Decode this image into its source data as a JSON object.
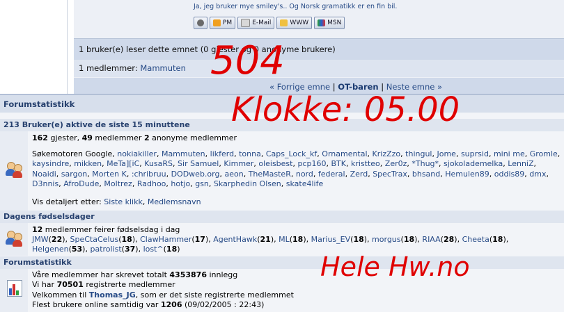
{
  "post": {
    "signature": "Ja, jeg bruker mye smiley's.. Og Norsk gramatikk er en fin bil.",
    "buttons": [
      "PM",
      "E-Mail",
      "WWW",
      "MSN"
    ]
  },
  "readers": {
    "reading_text": "1 bruker(e) leser dette emnet (0 gjester og 0 anonyme brukere)",
    "members_prefix": "1 medlemmer: ",
    "member": "Mammuten"
  },
  "nav": {
    "prev": "« Forrige emne",
    "sep1": " | ",
    "current": "OT-baren",
    "sep2": " | ",
    "next": "Neste emne »"
  },
  "stats": {
    "title": "Forumstatistikk",
    "active_header": "213 Bruker(e) aktive de siste 15 minuttene",
    "active_counts": {
      "guests_num": "162",
      "guests_label": " gjester, ",
      "members_num": "49",
      "members_label": " medlemmer ",
      "anon_num": "2",
      "anon_label": " anonyme medlemmer"
    },
    "online_prefix": "Søkemotoren Google, ",
    "online_users": [
      "nokiakiller",
      "Mammuten",
      "likferd",
      "tonna",
      "Caps_Lock_kf",
      "Ornamental",
      "KrizZzo",
      "thingul",
      "Jome",
      "suprsid",
      "mini me",
      "Gromle",
      "kaysindre",
      "mikken",
      "MeTa][iC",
      "KusaRS",
      "Sir Samuel",
      "Kimmer",
      "oleisbest",
      "pcp160",
      "BTK",
      "kristteo",
      "Zer0z",
      "*Thug*",
      "sjokolademelka",
      "LenniZ",
      "Noaidi",
      "sargon",
      "Morten K",
      ":chribruu",
      "DODweb.org",
      "aeon",
      "TheMasteR",
      "nord",
      "federal",
      "Zerd",
      "SpecTrax",
      "bhsand",
      "Hemulen89",
      "oddis89",
      "dmx",
      "D3nnis",
      "AfroDude",
      "Moltrez",
      "Radhoo",
      "hotjo",
      "gsn",
      "Skarphedin Olsen",
      "skate4life"
    ],
    "sort_prefix": "Vis detaljert etter: ",
    "sort_options": [
      "Siste klikk",
      "Medlemsnavn"
    ],
    "birthday_header": "Dagens fødselsdager",
    "birthday_count_num": "12",
    "birthday_count_label": " medlemmer feirer fødselsdag i dag",
    "birthdays": [
      {
        "name": "JMW",
        "age": "22"
      },
      {
        "name": "SpeCtaCelus",
        "age": "18"
      },
      {
        "name": "ClawHammer",
        "age": "17"
      },
      {
        "name": "AgentHawk",
        "age": "21"
      },
      {
        "name": "ML",
        "age": "18"
      },
      {
        "name": "Marius_EV",
        "age": "18"
      },
      {
        "name": "morgus",
        "age": "18"
      },
      {
        "name": "RIAA",
        "age": "28"
      },
      {
        "name": "Cheeta",
        "age": "18"
      },
      {
        "name": "Helgenen",
        "age": "53"
      },
      {
        "name": "patrolist",
        "age": "37"
      },
      {
        "name": "lost^",
        "age": "18"
      }
    ],
    "forum_header": "Forumstatistikk",
    "line1_prefix": "Våre medlemmer har skrevet totalt ",
    "total_posts": "4353876",
    "line1_suffix": " innlegg",
    "line2_prefix": "Vi har ",
    "total_members": "70501",
    "line2_suffix": " registrerte medlemmer",
    "line3_prefix": "Velkommen til ",
    "newest_member": "Thomas_JG",
    "line3_suffix": ", som er det siste registrerte medlemmet",
    "line4_prefix": "Flest brukere online samtidig var ",
    "max_online": "1206",
    "max_online_date": " (09/02/2005 : 22:43)"
  },
  "annotations": {
    "note1": "504",
    "note2": "Klokke: 05.00",
    "note3": "Hele Hw.no",
    "color": "#e00000"
  }
}
